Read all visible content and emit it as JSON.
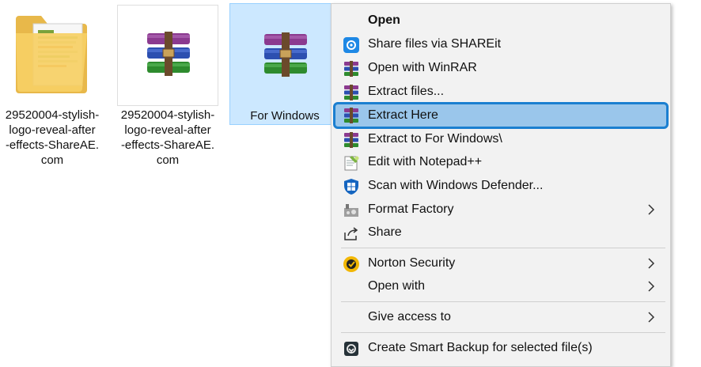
{
  "files": [
    {
      "label": "29520004-stylish-\nlogo-reveal-after\n-effects-ShareAE.\ncom",
      "type": "folder"
    },
    {
      "label": "29520004-stylish-\nlogo-reveal-after\n-effects-ShareAE.\ncom",
      "type": "rar-archive"
    },
    {
      "label": "For Windows",
      "type": "rar-archive",
      "selected": true
    }
  ],
  "context_menu": {
    "items": [
      {
        "label": "Open",
        "icon": "none",
        "bold": true
      },
      {
        "label": "Share files via SHAREit",
        "icon": "shareit-icon"
      },
      {
        "label": "Open with WinRAR",
        "icon": "winrar-icon"
      },
      {
        "label": "Extract files...",
        "icon": "winrar-icon"
      },
      {
        "label": "Extract Here",
        "icon": "winrar-icon",
        "highlighted": true
      },
      {
        "label": "Extract to For Windows\\",
        "icon": "winrar-icon"
      },
      {
        "label": "Edit with Notepad++",
        "icon": "notepad-plus-plus-icon"
      },
      {
        "label": "Scan with Windows Defender...",
        "icon": "windows-defender-icon"
      },
      {
        "label": "Format Factory",
        "icon": "format-factory-icon",
        "submenu": true
      },
      {
        "label": "Share",
        "icon": "share-icon"
      },
      {
        "label": "Norton Security",
        "icon": "norton-icon",
        "submenu": true
      },
      {
        "label": "Open with",
        "icon": "none",
        "submenu": true
      },
      {
        "label": "Give access to",
        "icon": "none",
        "submenu": true
      },
      {
        "label": "Create Smart Backup for selected file(s)",
        "icon": "smart-backup-icon"
      }
    ]
  },
  "colors": {
    "selection_bg": "#cce8ff",
    "highlight_bg": "#9ac6eb",
    "highlight_border": "#1b7fd0",
    "menu_bg": "#f2f2f2"
  }
}
